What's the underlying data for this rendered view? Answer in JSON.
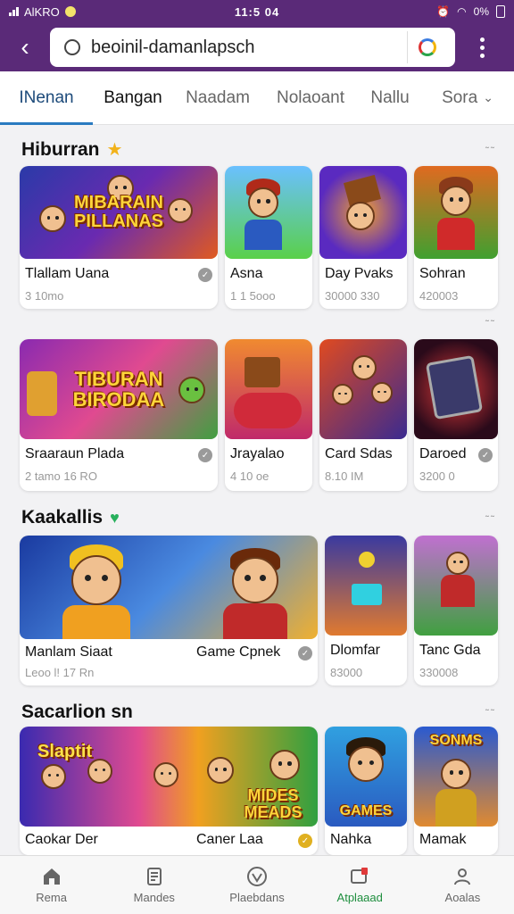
{
  "status": {
    "carrier": "AlKRO",
    "time": "11:5 04",
    "battery": "0%"
  },
  "search": {
    "value": "beoinil-damanlapsch"
  },
  "tabs": [
    {
      "label": "INenan"
    },
    {
      "label": "Bangan"
    },
    {
      "label": "Naadam"
    },
    {
      "label": "Nolaoant"
    },
    {
      "label": "Nallu"
    },
    {
      "label": "Sora"
    }
  ],
  "sections": [
    {
      "title": "Hiburran",
      "icon": "star-icon",
      "more": "˜˜"
    },
    {
      "title": "",
      "more": "˜˜"
    },
    {
      "title": "Kaakallis",
      "icon": "heart-icon",
      "more": "˜˜"
    },
    {
      "title": "Sacarlion sn",
      "more": "˜˜"
    }
  ],
  "row1": [
    {
      "thumb_text": "MIBARAIN PILLANAS",
      "name": "Tlallam Uana",
      "meta": "3 10mo"
    },
    {
      "name": "Asna",
      "meta": "1 1 5ooo"
    },
    {
      "name": "Day Pvaks",
      "meta": "30000 330"
    },
    {
      "name": "Sohran",
      "meta": "420003"
    }
  ],
  "row2": [
    {
      "thumb_text": "TIBURAN BIRODAA",
      "name": "Sraaraun Plada",
      "meta": "2 tamo 16 RO"
    },
    {
      "name": "Jrayalao",
      "meta": "4 10 oe"
    },
    {
      "name": "Card Sdas",
      "meta": "8.10 IM"
    },
    {
      "name": "Daroed",
      "meta": "3200 0"
    }
  ],
  "row3": [
    {
      "name": "Manlam Siaat",
      "name2": "Game Cpnek",
      "meta": "Leoo l! 17 Rn"
    },
    {
      "name": "Dlomfar",
      "meta": "83000"
    },
    {
      "name": "Tanc Gda",
      "meta": "330008"
    }
  ],
  "row4": [
    {
      "thumb_text": "Slaptit",
      "name": "Caokar Der",
      "name2": "Caner Laa",
      "thumb_text2": "MIDES MEADS"
    },
    {
      "thumb_text": "GAMES",
      "name": "Nahka"
    },
    {
      "thumb_text": "SONMS",
      "name": "Mamak"
    }
  ],
  "bottomnav": [
    {
      "label": "Rema",
      "icon": "home-icon"
    },
    {
      "label": "Mandes",
      "icon": "document-icon"
    },
    {
      "label": "Plaebdans",
      "icon": "heart-outline-icon"
    },
    {
      "label": "Atplaaad",
      "icon": "download-icon"
    },
    {
      "label": "Aoalas",
      "icon": "person-icon"
    }
  ],
  "colors": {
    "brand": "#5a2a78",
    "tab_active": "#2a7bc0",
    "nav_active": "#1e8e3e"
  }
}
